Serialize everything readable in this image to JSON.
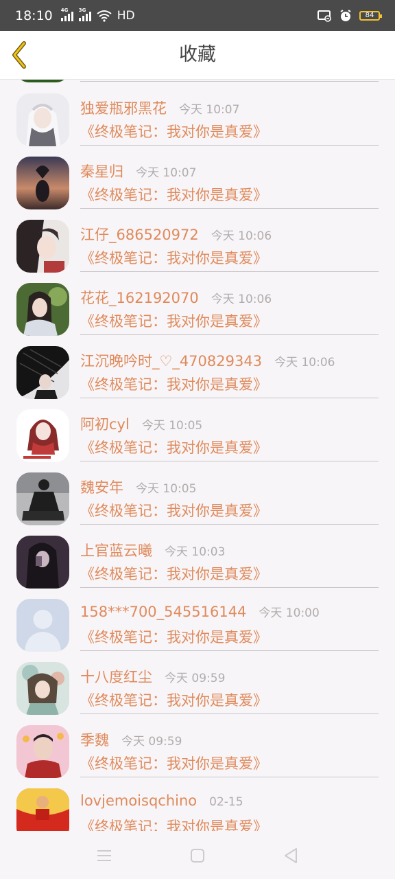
{
  "status_bar": {
    "time": "18:10",
    "signal1_label": "4G",
    "signal2_label": "3G",
    "network": "HD",
    "battery": "84"
  },
  "header": {
    "title": "收藏"
  },
  "items": [
    {
      "name": "独爱瓶邪黑花",
      "time": "今天 10:07",
      "book": "《终极笔记：我对你是真爱》",
      "avatar": "anime-white-hair"
    },
    {
      "name": "秦星归",
      "time": "今天 10:07",
      "book": "《终极笔记：我对你是真爱》",
      "avatar": "sunset-heart"
    },
    {
      "name": "江仔_686520972",
      "time": "今天 10:06",
      "book": "《终极笔记：我对你是真爱》",
      "avatar": "drawn-girl"
    },
    {
      "name": "花花_162192070",
      "time": "今天 10:06",
      "book": "《终极笔记：我对你是真爱》",
      "avatar": "girl-garden"
    },
    {
      "name": "江沉晚吟时_♡_470829343",
      "time": "今天 10:06",
      "book": "《终极笔记：我对你是真爱》",
      "avatar": "black-fan"
    },
    {
      "name": "阿初cyl",
      "time": "今天 10:05",
      "book": "《终极笔记：我对你是真爱》",
      "avatar": "red-hair-girl"
    },
    {
      "name": "魏安年",
      "time": "今天 10:05",
      "book": "《终极笔记：我对你是真爱》",
      "avatar": "sitting-man"
    },
    {
      "name": "上官蓝云曦",
      "time": "今天 10:03",
      "book": "《终极笔记：我对你是真爱》",
      "avatar": "dark-selfie"
    },
    {
      "name": "158***700_545516144",
      "time": "今天 10:00",
      "book": "《终极笔记：我对你是真爱》",
      "avatar": "default-person"
    },
    {
      "name": "十八度红尘",
      "time": "今天 09:59",
      "book": "《终极笔记：我对你是真爱》",
      "avatar": "painted-girl"
    },
    {
      "name": "季魏",
      "time": "今天 09:59",
      "book": "《终极笔记：我对你是真爱》",
      "avatar": "boy-cartoon"
    },
    {
      "name": "lovjemoisqchino",
      "time": "02-15",
      "book": "《终极笔记：我对你是真爱》",
      "avatar": "red-envelope"
    }
  ],
  "colors": {
    "accent": "#e08a5c",
    "time": "#b2acae",
    "back_arrow": "#f1c40f"
  }
}
